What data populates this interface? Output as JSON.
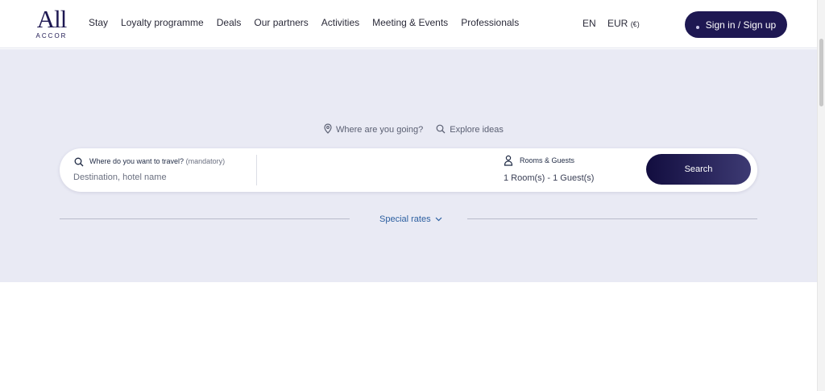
{
  "brand": {
    "logo_main": "All",
    "logo_sub": "ACCOR",
    "color": "#1e1852"
  },
  "nav": {
    "items": [
      "Stay",
      "Loyalty programme",
      "Deals",
      "Our partners",
      "Activities",
      "Meeting & Events",
      "Professionals"
    ]
  },
  "header": {
    "language": "EN",
    "currency": "EUR",
    "currency_symbol": "(€)",
    "signin_label": "Sign in / Sign up"
  },
  "search": {
    "tabs": [
      {
        "label": "Where are you going?",
        "icon": "location-pin-icon"
      },
      {
        "label": "Explore ideas",
        "icon": "search-icon"
      }
    ],
    "destination_label": "Where do you want to travel?",
    "destination_mandatory": "(mandatory)",
    "destination_placeholder": "Destination, hotel name",
    "rooms_label": "Rooms & Guests",
    "rooms_value": "1 Room(s) - 1 Guest(s)",
    "search_button": "Search"
  },
  "special_rates": {
    "label": "Special rates",
    "icon": "chevron-down-icon"
  },
  "colors": {
    "hero_background": "#e9eaf4",
    "link": "#2c5fa0",
    "primary": "#1e1852"
  }
}
